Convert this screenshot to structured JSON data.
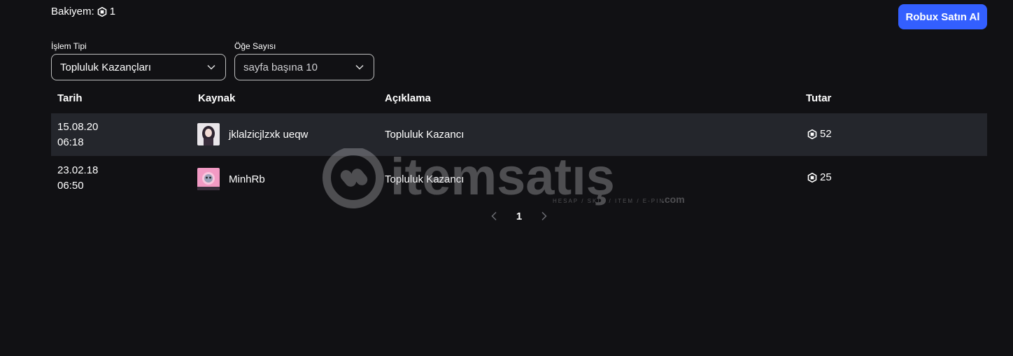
{
  "balance": {
    "label": "Bakiyem:",
    "amount": "1"
  },
  "buy_button": {
    "label": "Robux Satın Al"
  },
  "filters": {
    "type_label": "İşlem Tipi",
    "type_value": "Topluluk Kazançları",
    "count_label": "Öğe Sayısı",
    "count_value": "sayfa başına 10"
  },
  "table": {
    "headers": {
      "date": "Tarih",
      "source": "Kaynak",
      "description": "Açıklama",
      "amount": "Tutar"
    },
    "rows": [
      {
        "date": "15.08.20",
        "time": "06:18",
        "source": "jklalzicjlzxk ueqw",
        "description": "Topluluk Kazancı",
        "amount": "52"
      },
      {
        "date": "23.02.18",
        "time": "06:50",
        "source": "MinhRb",
        "description": "Topluluk Kazancı",
        "amount": "25"
      }
    ]
  },
  "pagination": {
    "current": "1"
  },
  "watermark": {
    "brand": "itemsatış",
    "tagline": "HESAP / SKIN / ITEM / E-PIN",
    "suffix": ".com"
  },
  "colors": {
    "background": "#111114",
    "accent": "#335fff",
    "row_shade": "#24262c"
  },
  "icons": {
    "currency": "robux-icon",
    "dropdown": "chevron-down-icon",
    "prev": "chevron-left-icon",
    "next": "chevron-right-icon"
  }
}
